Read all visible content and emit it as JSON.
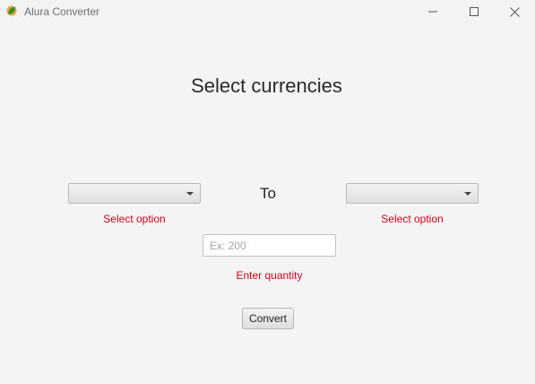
{
  "window": {
    "title": "Alura Converter",
    "icons": {
      "app": "alura-leaf-icon",
      "minimize": "minimize-icon",
      "maximize": "maximize-icon",
      "close": "close-icon"
    }
  },
  "main": {
    "heading": "Select currencies",
    "from_currency": {
      "value": "",
      "error": "Select option"
    },
    "separator": "To",
    "to_currency": {
      "value": "",
      "error": "Select option"
    },
    "quantity": {
      "value": "",
      "placeholder": "Ex: 200",
      "error": "Enter quantity"
    },
    "convert_label": "Convert"
  },
  "colors": {
    "background": "#f4f4f4",
    "error_text": "#d0021b",
    "icon_green": "#3a9a3a",
    "icon_orange": "#e8a33a"
  }
}
